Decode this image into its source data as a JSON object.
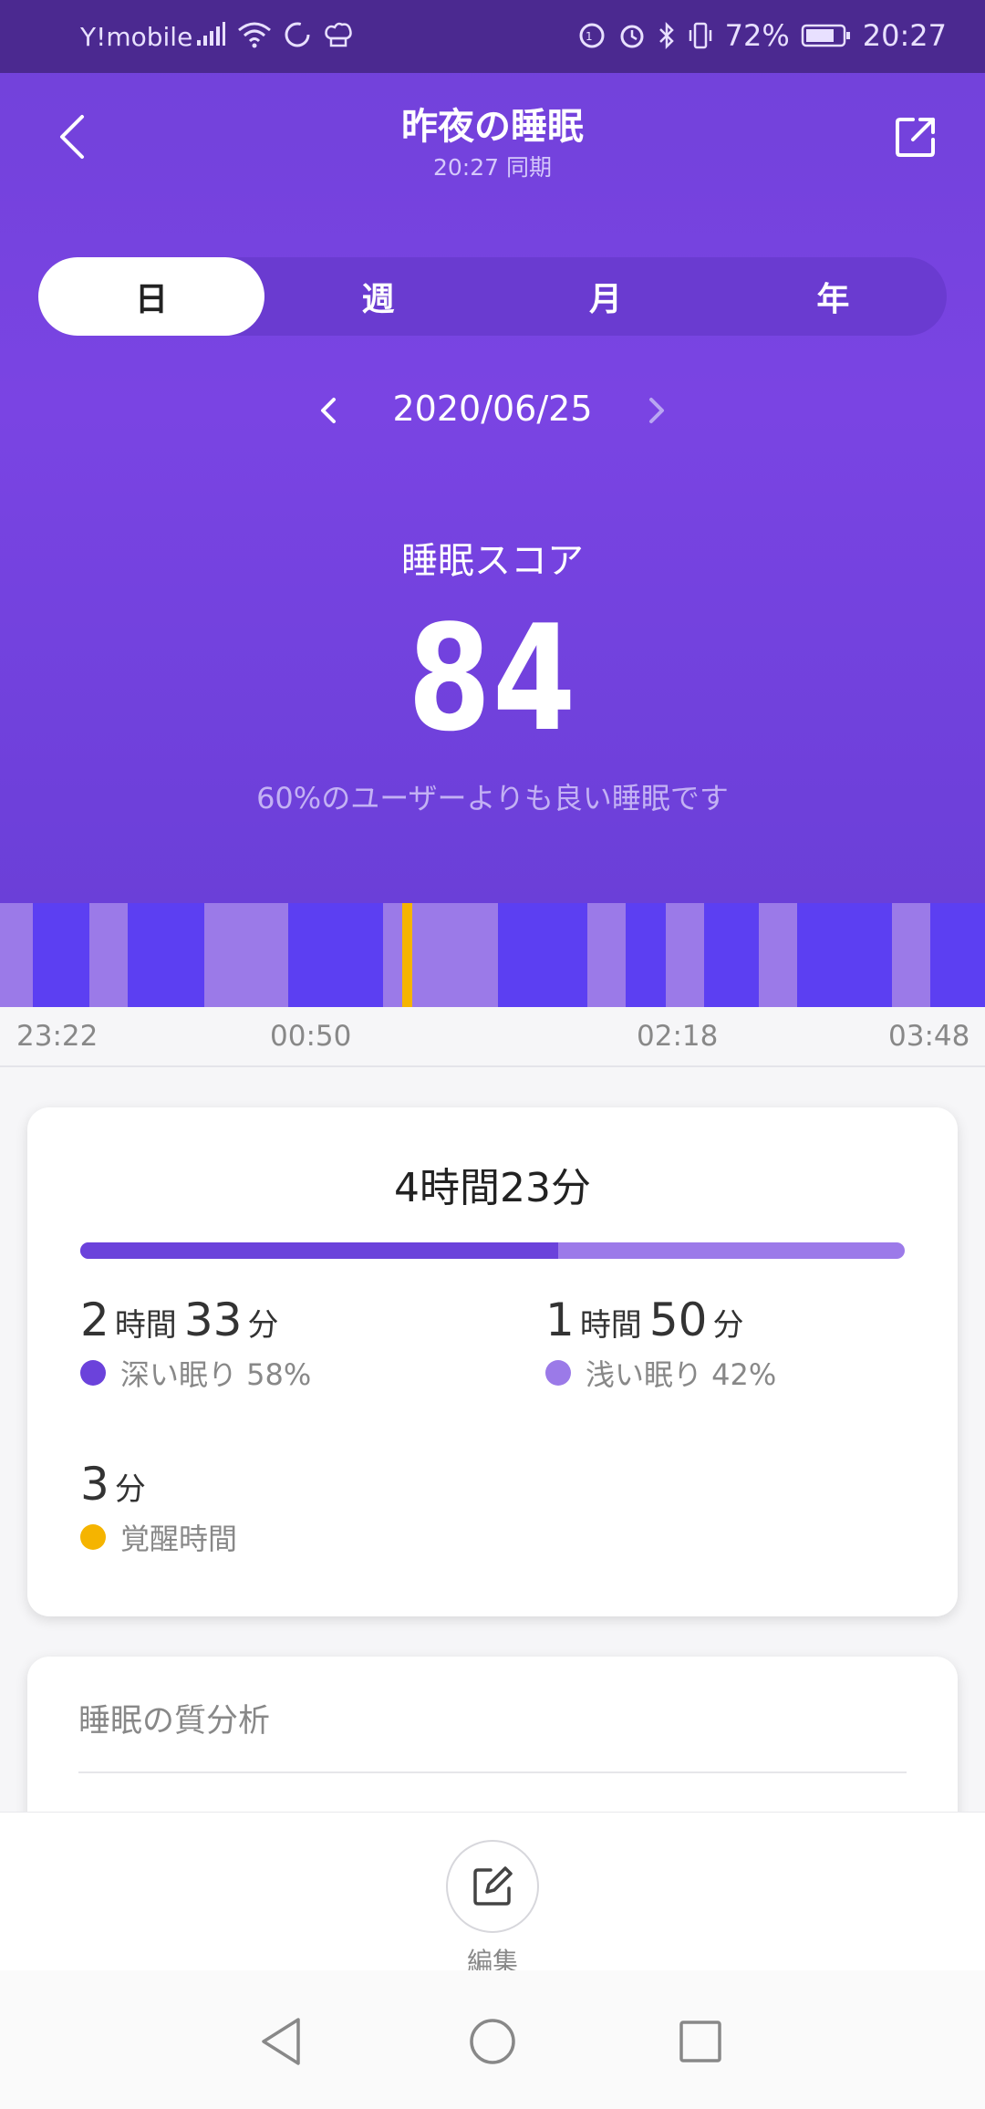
{
  "status_bar": {
    "carrier": "Y!mobile",
    "battery": "72%",
    "time": "20:27"
  },
  "header": {
    "title": "昨夜の睡眠",
    "subtitle": "20:27 同期"
  },
  "tabs": [
    {
      "label": "日",
      "active": true
    },
    {
      "label": "週",
      "active": false
    },
    {
      "label": "月",
      "active": false
    },
    {
      "label": "年",
      "active": false
    }
  ],
  "date_nav": {
    "date": "2020/06/25"
  },
  "score": {
    "label": "睡眠スコア",
    "value": "84",
    "comparison": "60%のユーザーよりも良い睡眠です"
  },
  "timeline": {
    "ticks": [
      "23:22",
      "00:50",
      "02:18",
      "03:48"
    ]
  },
  "summary": {
    "total": "4時間23分",
    "deep_fraction": 0.58,
    "deep": {
      "hours": "2",
      "hour_unit": "時間",
      "minutes": "33",
      "minute_unit": "分",
      "label": "深い眠り 58%"
    },
    "light": {
      "hours": "1",
      "hour_unit": "時間",
      "minutes": "50",
      "minute_unit": "分",
      "label": "浅い眠り 42%"
    },
    "awake": {
      "minutes": "3",
      "minute_unit": "分",
      "label": "覚醒時間"
    }
  },
  "quality": {
    "title": "睡眠の質分析"
  },
  "action": {
    "edit_label": "編集"
  },
  "colors": {
    "deep": "#5c3ff2",
    "light": "#9b7ae8",
    "awake": "#f5b400",
    "accent": "#7443dd"
  }
}
